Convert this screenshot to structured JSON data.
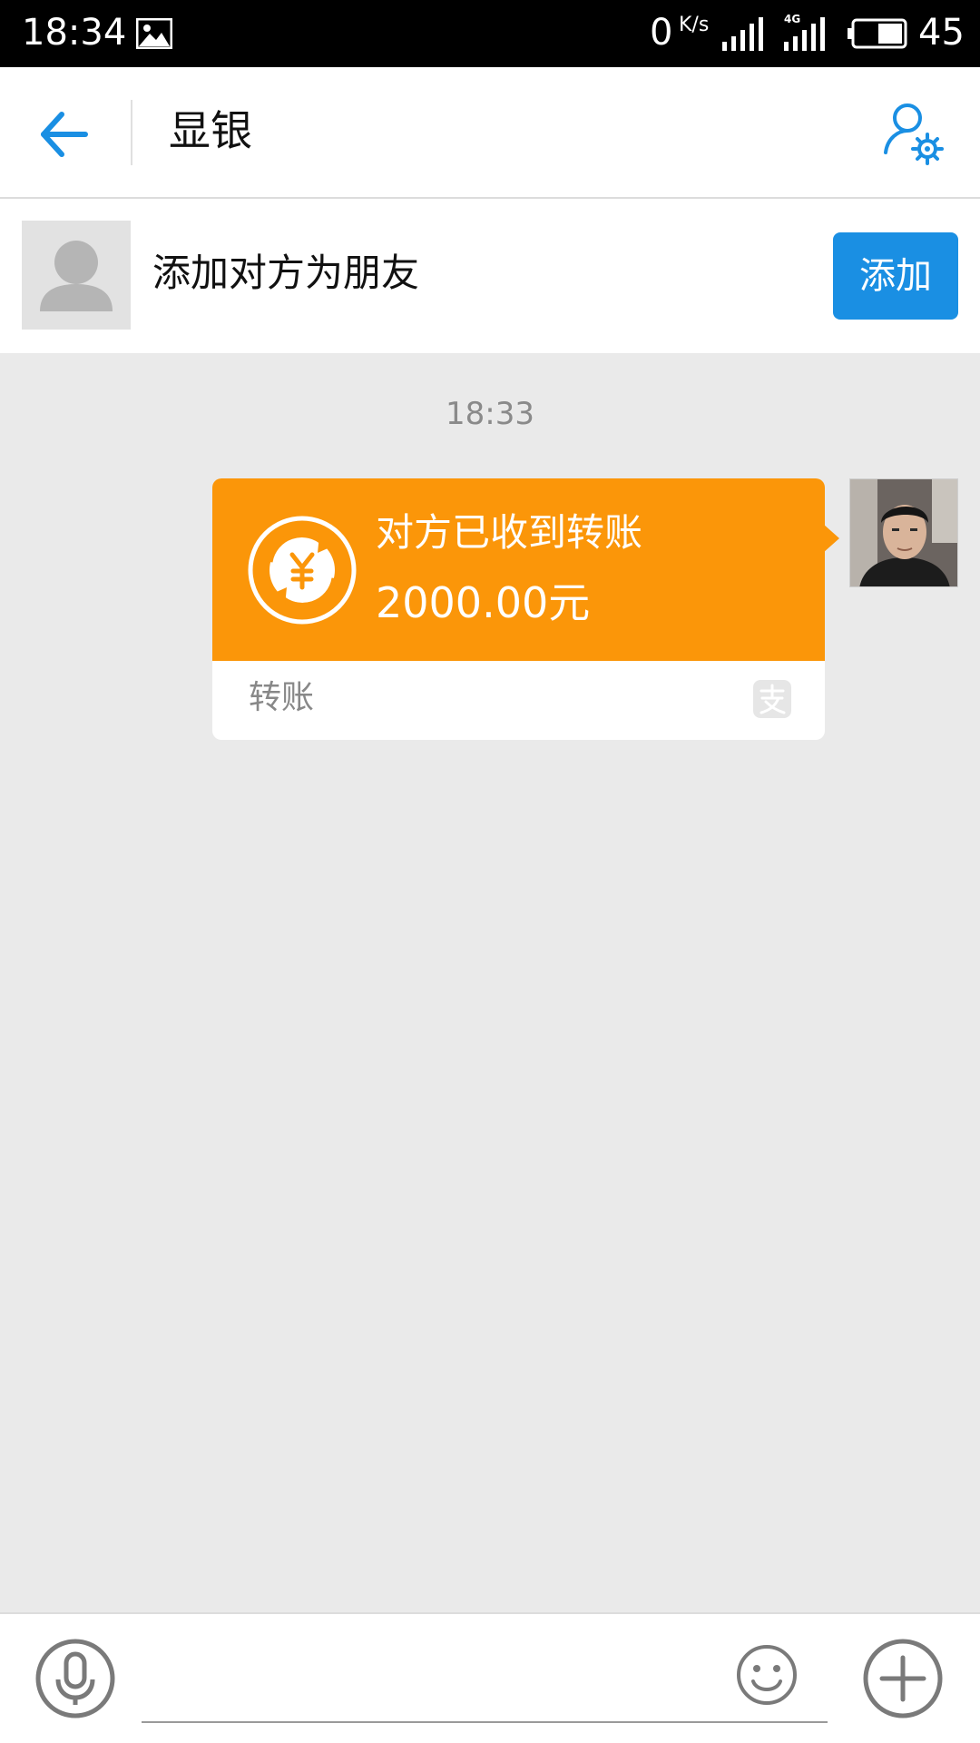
{
  "status_bar": {
    "time": "18:34",
    "network_speed": "0",
    "speed_unit": "K/s",
    "network_type": "4G",
    "battery_level": "45",
    "icons": [
      "photo-icon",
      "signal-icon",
      "signal-4g-icon",
      "battery-icon"
    ]
  },
  "header": {
    "title": "显银",
    "back_icon": "arrow-left-icon",
    "settings_icon": "user-settings-icon",
    "accent_color": "#1a8fe3"
  },
  "add_friend_bar": {
    "prompt": "添加对方为朋友",
    "button_label": "添加",
    "button_color": "#1a8fe3"
  },
  "chat": {
    "timestamp": "18:33",
    "messages": [
      {
        "type": "transfer",
        "sender": "self",
        "status": "对方已收到转账",
        "amount": "2000.00元",
        "label": "转账",
        "bubble_color": "#fb9609",
        "icons": [
          "yuan-transfer-icon",
          "alipay-icon"
        ]
      }
    ]
  },
  "input_bar": {
    "value": "",
    "placeholder": "",
    "icons": [
      "microphone-icon",
      "emoji-icon",
      "plus-icon"
    ]
  }
}
